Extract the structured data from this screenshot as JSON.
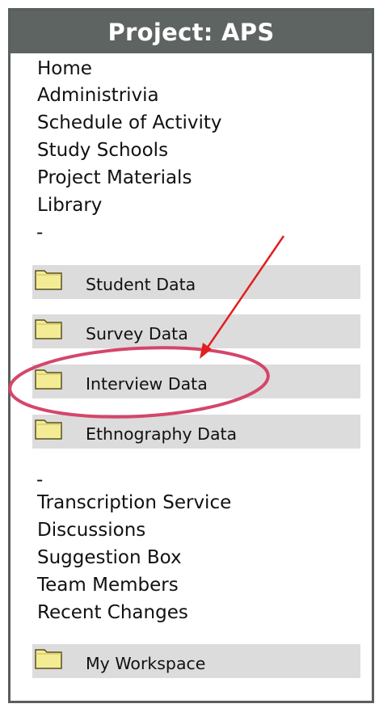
{
  "panel": {
    "title": "Project: APS",
    "nav_top": [
      "Home",
      "Administrivia",
      "Schedule of Activity",
      "Study Schools",
      "Project Materials",
      "Library"
    ],
    "separator": "-",
    "folders": [
      "Student Data",
      "Survey Data",
      "Interview Data",
      "Ethnography Data"
    ],
    "nav_bottom": [
      "Transcription Service",
      "Discussions",
      "Suggestion Box",
      "Team Members",
      "Recent Changes"
    ],
    "workspace": "My Workspace"
  },
  "icons": {
    "folder": "folder-icon"
  },
  "colors": {
    "title_bar": "#5e6461",
    "folder_row": "#dcdcdc",
    "folder_fill": "#f4ec94",
    "annotation_arrow": "#e02020",
    "annotation_circle": "#d4466a"
  }
}
